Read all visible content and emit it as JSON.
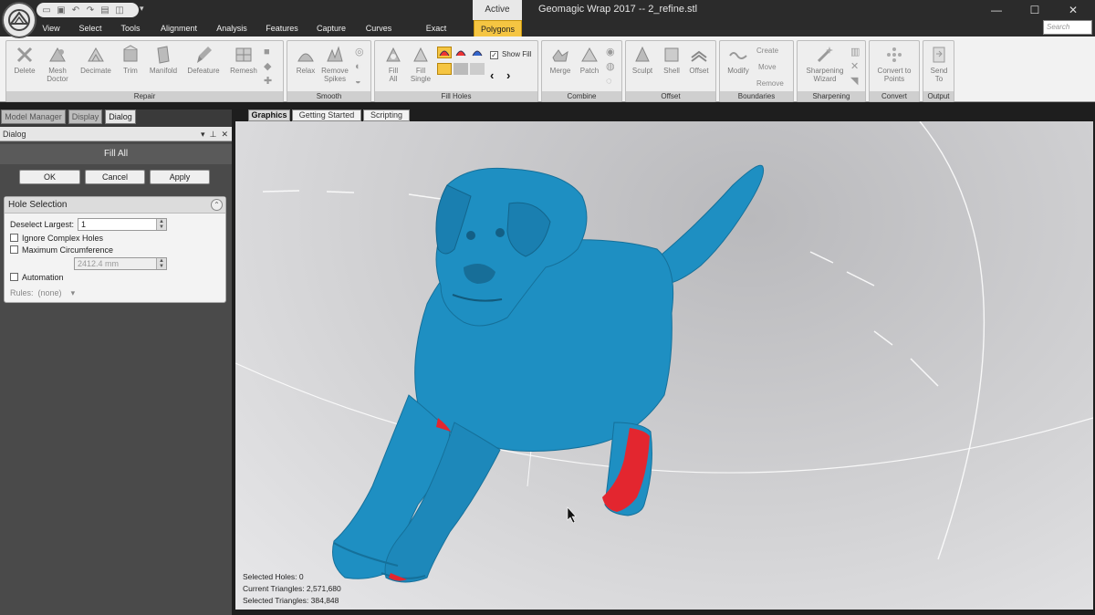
{
  "app": {
    "window_title": "Geomagic Wrap 2017 -- 2_refine.stl",
    "active_context": "Active",
    "search_placeholder": "Search"
  },
  "menu_tabs": [
    "View",
    "Select",
    "Tools",
    "Alignment",
    "Analysis",
    "Features",
    "Capture",
    "Curves",
    "Exact Surfaces",
    "Polygons"
  ],
  "active_menu_tab": "Polygons",
  "ribbon": {
    "repair": {
      "label": "Repair",
      "tools": [
        "Delete",
        "Mesh\nDoctor",
        "Decimate",
        "Trim",
        "Manifold",
        "Defeature",
        "Remesh"
      ]
    },
    "smooth": {
      "label": "Smooth",
      "tools": [
        "Relax",
        "Remove\nSpikes"
      ]
    },
    "fill_holes": {
      "label": "Fill Holes",
      "tools": [
        "Fill\nAll",
        "Fill\nSingle"
      ],
      "show_fill_label": "Show Fill"
    },
    "combine": {
      "label": "Combine",
      "tools": [
        "Merge",
        "Patch"
      ]
    },
    "offset": {
      "label": "Offset",
      "tools": [
        "Sculpt",
        "Shell",
        "Offset"
      ]
    },
    "boundaries": {
      "label": "Boundaries",
      "tools": [
        "Modify"
      ],
      "side": [
        "Create",
        "Move",
        "Remove"
      ]
    },
    "sharpening": {
      "label": "Sharpening",
      "tools": [
        "Sharpening\nWizard"
      ]
    },
    "convert": {
      "label": "Convert",
      "tools": [
        "Convert to\nPoints"
      ]
    },
    "output": {
      "label": "Output",
      "tools": [
        "Send\nTo"
      ]
    }
  },
  "panel_tabs": [
    "Model Manager",
    "Display",
    "Dialog"
  ],
  "active_panel_tab": "Dialog",
  "dialog": {
    "header": "Dialog",
    "title": "Fill All",
    "ok": "OK",
    "cancel": "Cancel",
    "apply": "Apply",
    "hole_selection": {
      "title": "Hole Selection",
      "deselect_largest_label": "Deselect Largest:",
      "deselect_largest_value": "1",
      "ignore_complex_holes": "Ignore Complex Holes",
      "max_circumference": "Maximum Circumference",
      "max_circumference_value": "2412.4 mm",
      "automation": "Automation",
      "rules_label": "Rules:",
      "rules_value": "(none)"
    }
  },
  "view_tabs": [
    "Graphics",
    "Getting Started",
    "Scripting"
  ],
  "active_view_tab": "Graphics",
  "stats": {
    "selected_holes": "Selected Holes: 0",
    "current_triangles": "Current Triangles: 2,571,680",
    "selected_triangles": "Selected Triangles: 384,848"
  },
  "colors": {
    "mesh": "#1e8fc2",
    "selection": "#e3262f",
    "active_tab": "#f5c542",
    "chrome": "#2b2b2b"
  }
}
